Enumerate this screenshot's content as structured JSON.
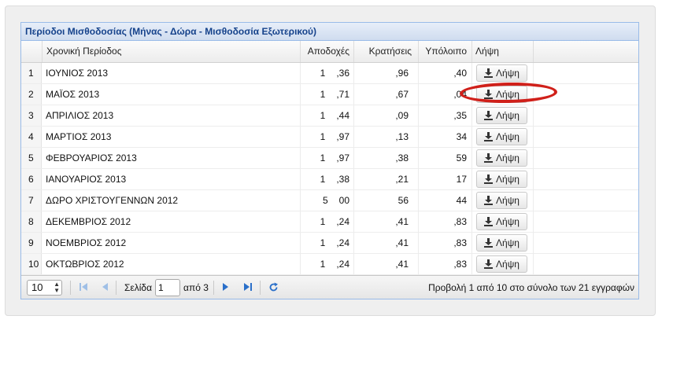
{
  "panel": {
    "title": "Περίοδοι Μισθοδοσίας (Μήνας - Δώρα - Μισθοδοσία Εξωτερικού)"
  },
  "columns": {
    "period": "Χρονική Περίοδος",
    "earnings": "Αποδοχές",
    "deductions": "Κρατήσεις",
    "balance": "Υπόλοιπο",
    "download": "Λήψη"
  },
  "rows": [
    {
      "n": "1",
      "period": "ΙΟΥΝΙΟΣ 2013",
      "earnings_prefix": "1",
      "earnings_suffix": ",36",
      "deductions": ",96",
      "balance": ",40",
      "download": "Λήψη"
    },
    {
      "n": "2",
      "period": "ΜΑΪΟΣ 2013",
      "earnings_prefix": "1",
      "earnings_suffix": ",71",
      "deductions": ",67",
      "balance": ",04",
      "download": "Λήψη"
    },
    {
      "n": "3",
      "period": "ΑΠΡΙΛΙΟΣ 2013",
      "earnings_prefix": "1",
      "earnings_suffix": ",44",
      "deductions": ",09",
      "balance": ",35",
      "download": "Λήψη"
    },
    {
      "n": "4",
      "period": "ΜΑΡΤΙΟΣ 2013",
      "earnings_prefix": "1",
      "earnings_suffix": ",97",
      "deductions": ",13",
      "balance": "34",
      "download": "Λήψη"
    },
    {
      "n": "5",
      "period": "ΦΕΒΡΟΥΑΡΙΟΣ 2013",
      "earnings_prefix": "1",
      "earnings_suffix": ",97",
      "deductions": ",38",
      "balance": "59",
      "download": "Λήψη"
    },
    {
      "n": "6",
      "period": "ΙΑΝΟΥΑΡΙΟΣ 2013",
      "earnings_prefix": "1",
      "earnings_suffix": ",38",
      "deductions": ",21",
      "balance": "17",
      "download": "Λήψη"
    },
    {
      "n": "7",
      "period": "ΔΩΡΟ ΧΡΙΣΤΟΥΓΕΝΝΩΝ 2012",
      "earnings_prefix": "5",
      "earnings_suffix": "00",
      "deductions": "56",
      "balance": "44",
      "download": "Λήψη"
    },
    {
      "n": "8",
      "period": "ΔΕΚΕΜΒΡΙΟΣ 2012",
      "earnings_prefix": "1",
      "earnings_suffix": ",24",
      "deductions": ",41",
      "balance": ",83",
      "download": "Λήψη"
    },
    {
      "n": "9",
      "period": "ΝΟΕΜΒΡΙΟΣ 2012",
      "earnings_prefix": "1",
      "earnings_suffix": ",24",
      "deductions": ",41",
      "balance": ",83",
      "download": "Λήψη"
    },
    {
      "n": "10",
      "period": "ΟΚΤΩΒΡΙΟΣ 2012",
      "earnings_prefix": "1",
      "earnings_suffix": ",24",
      "deductions": ",41",
      "balance": ",83",
      "download": "Λήψη"
    }
  ],
  "pager": {
    "page_size": "10",
    "page_label": "Σελίδα",
    "page_value": "1",
    "of_label": "από 3",
    "display_text": "Προβολή 1 από 10 στο σύνολο των 21 εγγραφών"
  },
  "icons": {
    "first": "first-page-icon",
    "prev": "prev-page-icon",
    "next": "next-page-icon",
    "last": "last-page-icon",
    "refresh": "refresh-icon",
    "download": "download-icon"
  },
  "colors": {
    "header_text": "#15428b",
    "border": "#99bbe8",
    "pager_icons": "#3a7ccf",
    "highlight_oval": "#d0201a"
  }
}
